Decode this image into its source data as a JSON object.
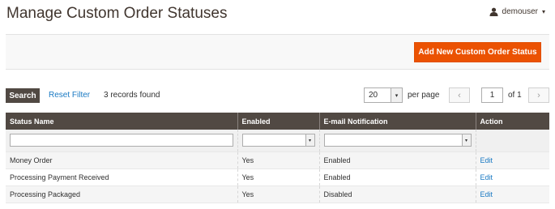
{
  "page": {
    "title": "Manage Custom Order Statuses"
  },
  "user": {
    "name": "demouser",
    "icon": "user-icon",
    "arrow": "▾"
  },
  "actions": {
    "add_new_label": "Add New Custom Order Status"
  },
  "toolbar": {
    "search_label": "Search",
    "reset_label": "Reset Filter",
    "records_text": "3 records found",
    "per_page_value": "20",
    "per_page_label": "per page",
    "prev_glyph": "‹",
    "next_glyph": "›",
    "current_page": "1",
    "of_text": "of 1",
    "dropdown_glyph": "▾"
  },
  "grid": {
    "columns": [
      "Status Name",
      "Enabled",
      "E-mail Notification",
      "Action"
    ],
    "rows": [
      {
        "name": "Money Order",
        "enabled": "Yes",
        "email": "Enabled",
        "action": "Edit"
      },
      {
        "name": "Processing Payment Received",
        "enabled": "Yes",
        "email": "Enabled",
        "action": "Edit"
      },
      {
        "name": "Processing Packaged",
        "enabled": "Yes",
        "email": "Disabled",
        "action": "Edit"
      }
    ]
  },
  "colors": {
    "accent": "#eb5202",
    "header": "#514943",
    "link": "#1979c3"
  }
}
